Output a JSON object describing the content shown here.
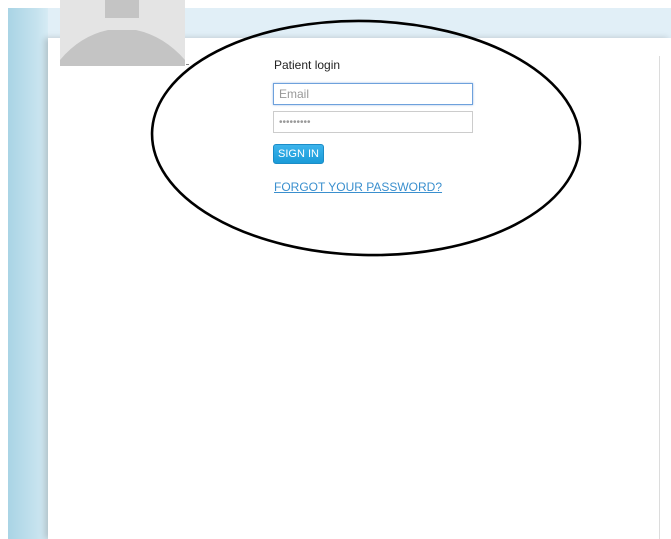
{
  "login": {
    "title": "Patient login",
    "email_placeholder": "Email",
    "password_placeholder": "•••••••••",
    "sign_in_label": "SIGN IN",
    "forgot_password_label": "FORGOT YOUR PASSWORD?"
  },
  "icons": {
    "avatar": "user-silhouette-icon"
  },
  "colors": {
    "accent": "#1a9bd8",
    "link": "#3a8fce",
    "side_band": "#a9d4e5",
    "top_band": "#e1eff7",
    "annotation": "#000000"
  }
}
